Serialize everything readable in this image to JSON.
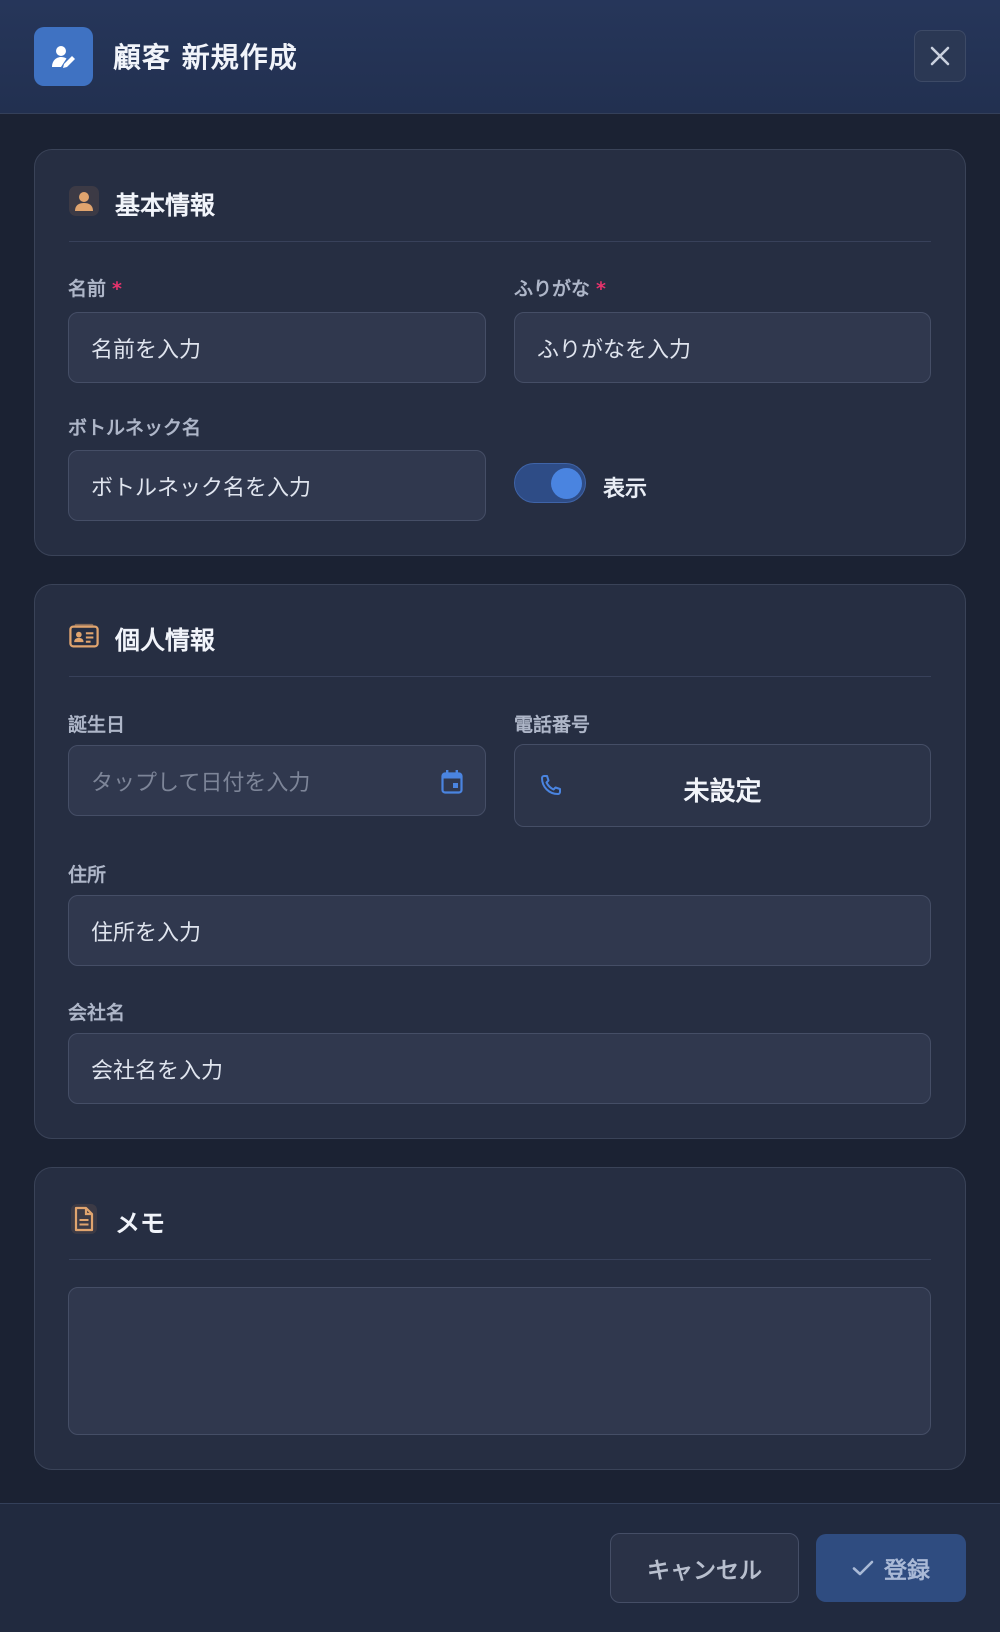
{
  "dialog": {
    "title": "顧客 新規作成",
    "close_icon": "close-icon",
    "header_icon": "user-edit-icon"
  },
  "basic": {
    "title": "基本情報",
    "icon": "person-icon",
    "name_label": "名前",
    "required_mark": "*",
    "name_placeholder": "名前を入力",
    "furigana_label": "ふりがな",
    "furigana_placeholder": "ふりがなを入力",
    "bottle_label": "ボトルネック名",
    "bottle_placeholder": "ボトルネック名を入力",
    "toggle_label": "表示",
    "toggle_on": true
  },
  "personal": {
    "title": "個人情報",
    "icon": "id-card-icon",
    "birthday_label": "誕生日",
    "birthday_placeholder": "タップして日付を入力",
    "phone_label": "電話番号",
    "phone_value": "未設定",
    "address_label": "住所",
    "address_placeholder": "住所を入力",
    "company_label": "会社名",
    "company_placeholder": "会社名を入力"
  },
  "memo": {
    "title": "メモ",
    "icon": "document-icon",
    "value": ""
  },
  "footer": {
    "cancel_label": "キャンセル",
    "submit_label": "登録"
  },
  "colors": {
    "accent": "#3f72c2",
    "section_icon": "#e0a46e",
    "required": "#e8336d"
  }
}
